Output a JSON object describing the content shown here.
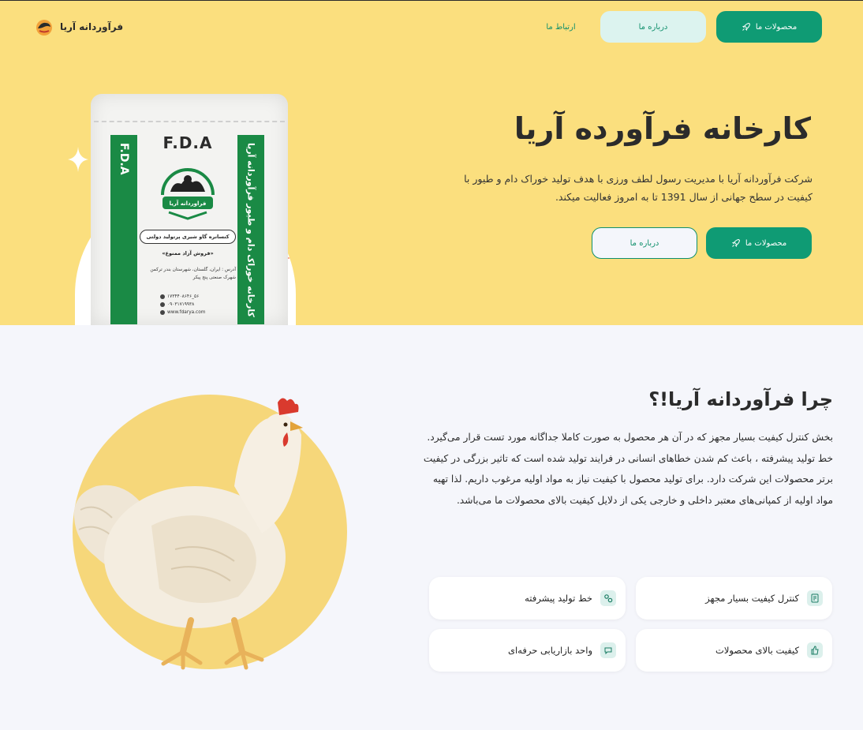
{
  "brand": {
    "name": "فرآوردانه آریا"
  },
  "nav": {
    "products": "محصولات ما",
    "about": "درباره ما",
    "contact": "ارتباط ما"
  },
  "hero": {
    "title": "کارخانه فرآورده آریا",
    "description": "شرکت فرآوردانه آریا با مدیریت رسول لطف ورزی با هدف تولید خوراک دام و طیور با کیفیت در سطح جهانی از سال 1391 تا به امروز فعالیت میکند.",
    "btn_products": "محصولات ما",
    "btn_about": "درباره ما"
  },
  "sack": {
    "brand": "F.D.A",
    "stripe_left": "F.D.A",
    "stripe_right": "کارخانه خوراک دام و طیور فرآوردانه آریا",
    "emblem_text": "فراوردانه آریا",
    "product": "کنسانره گاو شیری پرتولید دولتی",
    "free": "«فروش آزاد ممنوع»",
    "address": "آدرس : ایران، گلستان، شهرستان بندر ترکمن شهرک صنعتی پنج پیکر",
    "phone": "۱۷۳۴۴۰۸۶۴۶_۵۶",
    "mobile": "۰۹۰۳۱۷۱۹۹۳۸",
    "web": "www.fdarya.com"
  },
  "why": {
    "title": "چرا فرآوردانه آریا!؟",
    "description": "بخش کنترل کیفیت بسیار مجهز که در آن هر محصول به صورت کاملا جداگانه مورد تست قرار می‌گیرد. خط تولید پیشرفته ، باعث کم شدن خطاهای انسانی در فرایند تولید شده است که تاثیر بزرگی در کیفیت برتر محصولات این شرکت دارد. برای تولید محصول با کیفیت نیاز به مواد اولیه مرغوب داریم. لذا تهیه مواد اولیه از کمپانی‌های معتبر داخلی و خارجی یکی از دلایل کیفیت بالای محصولات ما می‌باشد."
  },
  "features": [
    {
      "label": "کنترل کیفیت بسیار مجهز",
      "icon": "lab-icon"
    },
    {
      "label": "خط تولید پیشرفته",
      "icon": "gears-icon"
    },
    {
      "label": "کیفیت بالای محصولات",
      "icon": "thumbs-up-icon"
    },
    {
      "label": "واحد بازاریابی حرفه‌ای",
      "icon": "chat-icon"
    }
  ],
  "colors": {
    "hero_bg": "#fbdf7e",
    "accent": "#0f9b74",
    "accent_light": "#dcf3ef",
    "page_bg": "#f5f6fb"
  }
}
